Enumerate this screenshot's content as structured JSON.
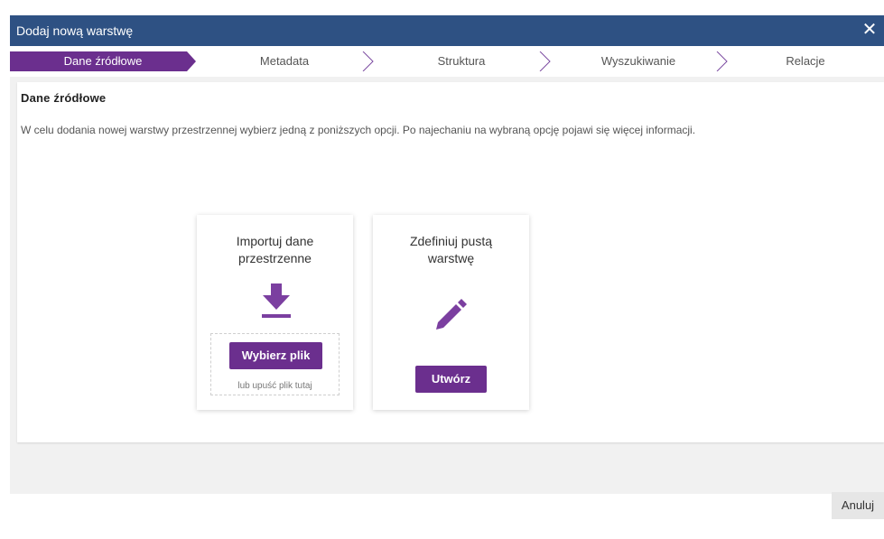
{
  "dialog": {
    "title": "Dodaj nową warstwę",
    "close_glyph": "✕"
  },
  "steps": [
    {
      "label": "Dane źródłowe",
      "active": true
    },
    {
      "label": "Metadata",
      "active": false
    },
    {
      "label": "Struktura",
      "active": false
    },
    {
      "label": "Wyszukiwanie",
      "active": false
    },
    {
      "label": "Relacje",
      "active": false
    }
  ],
  "panel": {
    "heading": "Dane źródłowe",
    "description": "W celu dodania nowej warstwy przestrzennej wybierz jedną z poniższych opcji. Po najechaniu na wybraną opcję pojawi się więcej informacji."
  },
  "cards": {
    "import": {
      "title_line1": "Importuj dane",
      "title_line2": "przestrzenne",
      "icon": "download-icon",
      "button_label": "Wybierz plik",
      "drop_hint": "lub upuść plik tutaj"
    },
    "define": {
      "title_line1": "Zdefiniuj pustą",
      "title_line2": "warstwę",
      "icon": "pencil-icon",
      "button_label": "Utwórz"
    }
  },
  "footer": {
    "cancel_label": "Anuluj"
  },
  "colors": {
    "titlebar": "#2e5183",
    "accent": "#6b2f8e",
    "step_active": "#6b2f8e"
  }
}
